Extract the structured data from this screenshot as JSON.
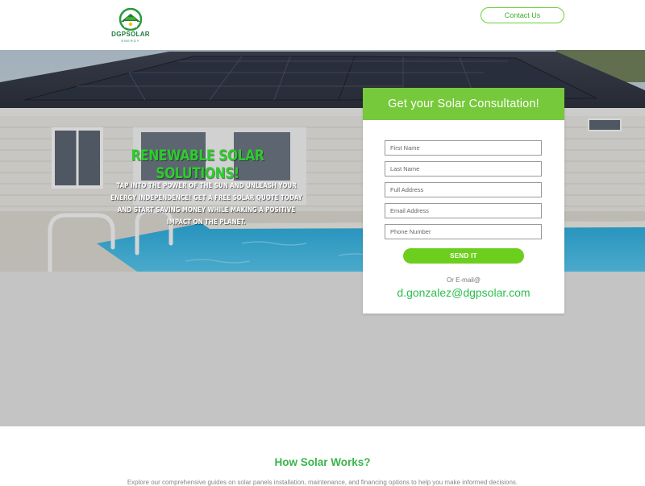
{
  "header": {
    "logo_text": "DGPSOLAR",
    "logo_subtext": "ENERGY",
    "contact_label": "Contact Us"
  },
  "hero": {
    "title": "RENEWABLE SOLAR SOLUTIONS!",
    "text": "TAP INTO THE POWER OF THE SUN AND UNLEASH YOUR ENERGY INDEPENDENCE! GET A FREE SOLAR QUOTE TODAY AND START SAVING MONEY WHILE MAKING A POSITIVE IMPACT ON THE PLANET."
  },
  "form": {
    "title": "Get your Solar Consultation!",
    "fields": {
      "first_name": "First Name",
      "last_name": "Last Name",
      "full_address": "Full Address",
      "email": "Email Address",
      "phone": "Phone Number"
    },
    "submit_label": "SEND IT",
    "or_email": "Or E-mail@",
    "email": "d.gonzalez@dgpsolar.com"
  },
  "how": {
    "title": "How Solar Works?",
    "text": "Explore our comprehensive guides on solar panels installation, maintenance, and financing options to help you make informed decisions."
  },
  "colors": {
    "accent_green": "#76c93a",
    "button_green": "#6ccf1e",
    "brand_green": "#1f7a3a",
    "band_gray": "#c4c4c4"
  }
}
